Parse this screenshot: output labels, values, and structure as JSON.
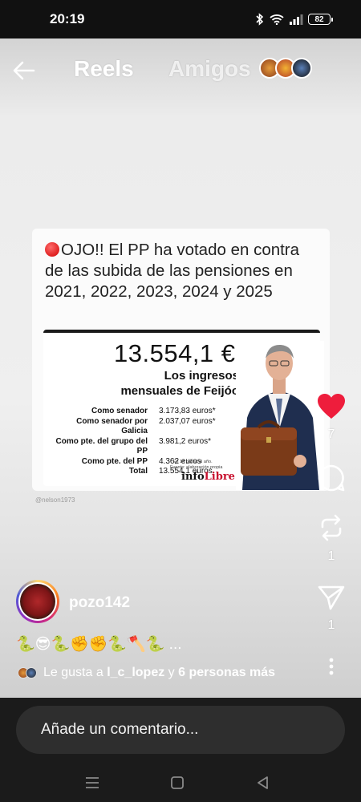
{
  "status_bar": {
    "time": "20:19",
    "battery": "82"
  },
  "header": {
    "tabs": [
      {
        "label": "Reels"
      },
      {
        "label": "Amigos"
      }
    ],
    "icons": [
      "back-arrow-icon",
      "friend-avatars"
    ]
  },
  "post_image": {
    "headline": "OJO!! El PP ha votado en contra de las subida de las pensiones en 2021, 2022, 2023, 2024 y 2025",
    "amount": "13.554,1 €",
    "subtitle": "Los ingresos mensuales de Feijóo",
    "income_rows": [
      {
        "label": "Como senador",
        "value": "3.173,83 euros*"
      },
      {
        "label": "Como senador por Galicia",
        "value": "2.037,07 euros*"
      },
      {
        "label": "Como pte. del grupo del PP",
        "value": "3.981,2 euros*"
      },
      {
        "label": "Como pte. del PP",
        "value": "4.362 euros"
      },
      {
        "label": "Total",
        "value": "13.554,1 euros"
      }
    ],
    "footnote_1": "* En 14 pagas al año.",
    "footnote_2": "Fuente: elaboración propia",
    "source_brand_1": "info",
    "source_brand_2": "Libre",
    "watermark": "@nelson1973"
  },
  "actions": {
    "like_count": "7",
    "repost_count": "1",
    "share_count": "1",
    "icons": [
      "heart-icon",
      "comment-icon",
      "repost-icon",
      "share-icon",
      "more-icon"
    ],
    "like_color": "#ee1d3c"
  },
  "author": {
    "username": "pozo142",
    "caption": "🐍😎🐍✊✊🐍🪓🐍 ..."
  },
  "likes": {
    "prefix": "Le gusta a",
    "user": "l_c_lopez",
    "middle": "y",
    "others": "6 personas más"
  },
  "comment": {
    "placeholder": "Añade un comentario..."
  },
  "nav": {
    "icons": [
      "recents-icon",
      "home-icon",
      "back-icon"
    ]
  }
}
